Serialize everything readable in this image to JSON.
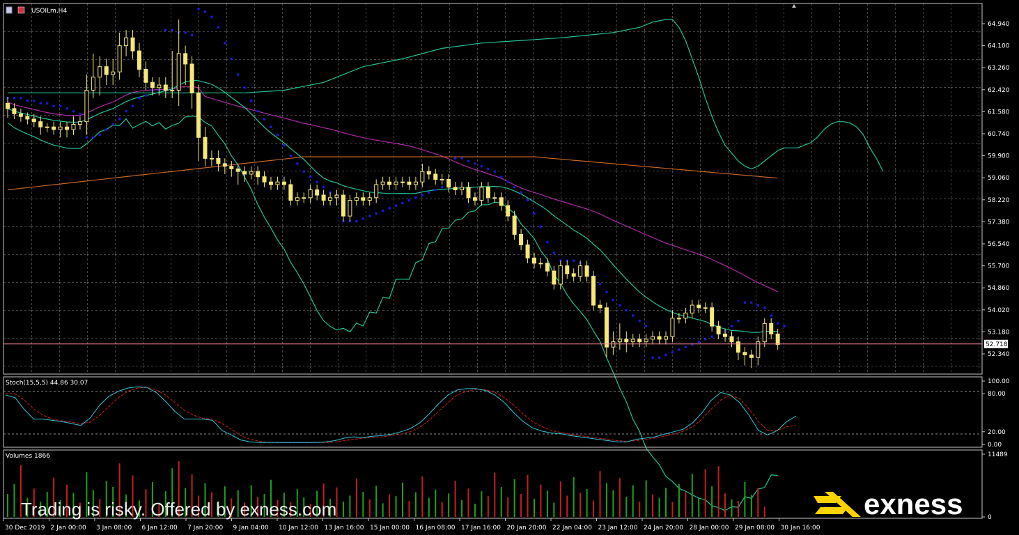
{
  "window": {
    "symbol_title": "USOILm,H4"
  },
  "colors": {
    "background": "#000000",
    "grid": "#8a8a8a",
    "frame": "#c8c8c8",
    "candle": "#f5e878",
    "bollinger": "#22c49a",
    "sar": "#1a1adc",
    "ma_magenta": "#b02aa8",
    "ma_orange": "#c8641e",
    "price_line": "#ff8fa0",
    "stoch_main": "#2ec6d8",
    "stoch_signal": "#d41c1c",
    "vol_up": "#1ea01e",
    "vol_down": "#c81e1e",
    "text": "#ffffff",
    "brand_yellow": "#ffd300"
  },
  "chart_data": [
    {
      "type": "candlestick",
      "title": "USOILm,H4",
      "price_axis_ticks": [
        "64.940",
        "64.100",
        "63.260",
        "62.420",
        "61.580",
        "60.740",
        "59.900",
        "59.060",
        "58.220",
        "57.380",
        "56.540",
        "55.700",
        "54.860",
        "54.020",
        "53.180",
        "52.340"
      ],
      "ylim": [
        51.85,
        65.5
      ],
      "current_price": "52.718",
      "time_axis_labels": [
        "30 Dec 2019",
        "2 Jan 00:00",
        "3 Jan 08:00",
        "6 Jan 12:00",
        "7 Jan 20:00",
        "9 Jan 04:00",
        "10 Jan 12:00",
        "13 Jan 16:00",
        "15 Jan 00:00",
        "16 Jan 08:00",
        "17 Jan 16:00",
        "20 Jan 20:00",
        "22 Jan 04:00",
        "23 Jan 12:00",
        "24 Jan 20:00",
        "28 Jan 00:00",
        "29 Jan 08:00",
        "30 Jan 16:00"
      ],
      "close": [
        61.7,
        61.5,
        61.4,
        61.3,
        61.2,
        61.0,
        61.0,
        60.9,
        61.0,
        60.9,
        61.1,
        61.2,
        62.4,
        62.9,
        63.3,
        63.0,
        63.1,
        64.1,
        64.4,
        63.9,
        63.2,
        62.7,
        62.5,
        62.6,
        62.4,
        62.4,
        63.8,
        63.4,
        62.3,
        60.6,
        59.8,
        59.8,
        59.6,
        59.5,
        59.4,
        59.3,
        59.2,
        59.3,
        59.1,
        58.9,
        58.8,
        58.9,
        58.8,
        58.2,
        58.3,
        58.3,
        58.6,
        58.4,
        58.2,
        58.3,
        58.4,
        57.6,
        58.2,
        58.3,
        58.2,
        58.3,
        58.8,
        58.9,
        58.8,
        58.9,
        58.9,
        58.8,
        58.9,
        59.3,
        59.2,
        59.0,
        59.0,
        58.7,
        58.6,
        58.7,
        58.3,
        58.2,
        58.7,
        58.3,
        58.3,
        58.0,
        57.6,
        56.9,
        56.5,
        56.0,
        55.8,
        55.8,
        55.5,
        55.0,
        55.7,
        55.4,
        55.3,
        55.7,
        55.3,
        54.2,
        54.1,
        52.6,
        52.8,
        52.9,
        52.8,
        52.9,
        52.8,
        52.9,
        53.0,
        52.9,
        53.0,
        53.7,
        53.7,
        53.9,
        54.2,
        54.1,
        54.1,
        53.4,
        53.1,
        53.0,
        52.8,
        52.4,
        52.3,
        52.2,
        52.8,
        53.5,
        53.1,
        52.7
      ],
      "open_first": 61.9,
      "high_ext": [
        0.25,
        0.2,
        0.2,
        0.15,
        0.2,
        0.2,
        0.15,
        0.2,
        0.2,
        0.2,
        0.3,
        0.2,
        0.6,
        0.9,
        0.4,
        0.3,
        0.5,
        0.5,
        0.3,
        0.3,
        0.3,
        0.3,
        0.2,
        0.3,
        0.3,
        1.5,
        1.3,
        0.3,
        0.3,
        0.3,
        0.4,
        0.3,
        0.3,
        0.2,
        0.2,
        0.2,
        0.2,
        0.2,
        0.2,
        0.2,
        0.2,
        0.2,
        0.2,
        0.2,
        0.2,
        0.2,
        0.2,
        0.2,
        0.2,
        0.2,
        0.2,
        0.2,
        0.2,
        0.2,
        0.2,
        0.2,
        0.2,
        0.2,
        0.2,
        0.2,
        0.2,
        0.2,
        0.2,
        0.3,
        0.2,
        0.2,
        0.2,
        0.2,
        0.2,
        0.2,
        0.2,
        0.2,
        0.2,
        0.2,
        0.2,
        0.2,
        0.2,
        0.2,
        0.2,
        0.2,
        0.2,
        0.2,
        0.2,
        0.2,
        0.2,
        0.2,
        0.2,
        0.2,
        0.2,
        0.2,
        0.2,
        0.2,
        0.4,
        0.6,
        0.3,
        0.2,
        0.2,
        0.2,
        0.2,
        0.2,
        0.2,
        0.3,
        0.2,
        0.2,
        0.2,
        0.2,
        0.2,
        0.2,
        0.2,
        0.2,
        0.2,
        0.2,
        0.2,
        0.2,
        0.2,
        0.2,
        0.2,
        0.2
      ],
      "low_ext": [
        0.35,
        0.2,
        0.2,
        0.2,
        0.2,
        0.3,
        0.2,
        0.2,
        0.3,
        0.3,
        0.2,
        0.2,
        0.5,
        0.3,
        0.7,
        0.4,
        0.4,
        0.3,
        0.4,
        0.3,
        0.3,
        0.3,
        0.3,
        0.3,
        0.3,
        0.3,
        0.6,
        0.8,
        0.6,
        0.9,
        0.3,
        0.3,
        0.3,
        0.3,
        0.3,
        0.5,
        0.3,
        0.2,
        0.3,
        0.2,
        0.2,
        0.2,
        0.2,
        0.2,
        0.2,
        0.2,
        0.2,
        0.2,
        0.2,
        0.2,
        0.3,
        0.2,
        0.2,
        0.2,
        0.2,
        0.2,
        0.2,
        0.2,
        0.2,
        0.2,
        0.2,
        0.2,
        0.2,
        0.2,
        0.2,
        0.2,
        0.2,
        0.2,
        0.2,
        0.2,
        0.2,
        0.2,
        0.2,
        0.2,
        0.2,
        0.2,
        0.2,
        0.2,
        0.2,
        0.2,
        0.2,
        0.2,
        0.2,
        0.2,
        0.2,
        0.2,
        0.2,
        0.2,
        0.2,
        0.2,
        0.2,
        0.4,
        0.3,
        0.3,
        0.4,
        0.2,
        0.2,
        0.2,
        0.2,
        0.2,
        0.2,
        0.2,
        0.2,
        0.2,
        0.2,
        0.2,
        0.2,
        0.2,
        0.2,
        0.2,
        0.2,
        0.3,
        0.4,
        0.4,
        0.3,
        0.2,
        0.2,
        0.2
      ],
      "bollinger_upper": [
        62.3,
        62.3,
        62.3,
        62.3,
        62.3,
        62.3,
        62.3,
        62.4,
        62.7,
        63.3,
        63.6,
        64.0,
        64.2,
        64.3,
        64.4,
        64.5,
        64.6,
        64.7,
        64.8,
        64.9,
        65.0,
        65.05,
        65.1,
        65.1,
        64.8,
        64.3,
        63.6,
        62.9,
        62.1,
        61.4,
        60.8,
        60.3,
        60.0,
        59.7,
        59.5,
        59.4,
        59.5,
        59.7,
        59.9,
        60.1,
        60.2,
        60.2,
        60.2,
        60.3,
        60.4,
        60.6,
        60.9,
        61.1,
        61.2,
        61.2,
        61.15,
        61.0,
        60.7,
        60.2,
        59.8,
        59.3
      ],
      "bollinger_upper_x": [
        0,
        6,
        12,
        18,
        24,
        30,
        36,
        42,
        48,
        54,
        60,
        66,
        72,
        78,
        84,
        88,
        92,
        94,
        96,
        97,
        98,
        99,
        100,
        101,
        102,
        103,
        104,
        105,
        106,
        107,
        108,
        109,
        110,
        111,
        112,
        113,
        114,
        115,
        116,
        117,
        118,
        119,
        120,
        121,
        122,
        123,
        124,
        125,
        126,
        127,
        128,
        129,
        130,
        131,
        132,
        133
      ],
      "parabolic_sar": [
        62.1,
        62.1,
        62.1,
        62.0,
        62.0,
        61.9,
        61.9,
        61.8,
        61.8,
        61.7,
        61.6,
        61.5,
        60.6,
        60.6,
        60.7,
        60.9,
        61.1,
        61.3,
        61.6,
        61.8,
        62.1,
        62.2,
        62.4,
        62.4,
        64.7,
        64.7,
        64.6,
        64.6,
        64.5,
        65.5,
        65.4,
        65.2,
        64.8,
        64.2,
        63.6,
        63.0,
        62.5,
        62.0,
        61.6,
        61.3,
        61.0,
        60.7,
        60.3,
        59.9,
        59.6,
        59.3,
        59.1,
        58.9,
        58.7,
        58.5,
        58.4,
        57.4,
        57.4,
        57.4,
        57.5,
        57.6,
        57.7,
        57.8,
        57.9,
        58.0,
        58.1,
        58.2,
        58.3,
        58.4,
        58.5,
        58.6,
        58.7,
        58.8,
        59.8,
        59.8,
        59.7,
        59.6,
        59.5,
        59.4,
        59.3,
        59.1,
        58.9,
        58.7,
        58.5,
        58.2,
        57.7,
        57.2,
        56.6,
        56.2,
        55.9,
        55.9,
        55.9,
        55.8,
        55.6,
        55.3,
        55.0,
        54.7,
        54.4,
        54.2,
        54.0,
        53.8,
        53.6,
        53.4,
        52.2,
        52.2,
        52.3,
        52.4,
        52.5,
        52.6,
        52.7,
        52.8,
        52.9,
        53.0,
        53.1,
        53.2,
        53.4,
        53.6,
        54.3,
        54.3,
        54.2,
        54.1,
        53.8,
        53.5,
        53.4
      ]
    },
    {
      "type": "line",
      "title": "Stoch(15,5,5) 44.86 30.07",
      "axis_ticks": [
        "100.00",
        "80.00",
        "20.00",
        "0.00"
      ],
      "ylim": [
        0,
        100
      ],
      "series_main": [
        78,
        74,
        55,
        40,
        40,
        38,
        36,
        33,
        30,
        42,
        62,
        76,
        84,
        89,
        91,
        90,
        82,
        68,
        52,
        40,
        40,
        40,
        38,
        22,
        15,
        7,
        4,
        3,
        3,
        3,
        3,
        3,
        3,
        3,
        4,
        6,
        10,
        12,
        11,
        13,
        14,
        16,
        20,
        25,
        34,
        48,
        64,
        78,
        86,
        88,
        88,
        85,
        78,
        66,
        50,
        36,
        26,
        21,
        18,
        17,
        14,
        12,
        10,
        8,
        6,
        4,
        4,
        8,
        10,
        12,
        16,
        20,
        24,
        34,
        50,
        70,
        82,
        78,
        66,
        46,
        22,
        15,
        22,
        36,
        44.86
      ],
      "series_signal": [
        80,
        80,
        70,
        56,
        46,
        40,
        37,
        35,
        33,
        35,
        46,
        60,
        74,
        84,
        89,
        90,
        86,
        78,
        66,
        54,
        46,
        41,
        40,
        33,
        24,
        14,
        8,
        5,
        3,
        3,
        3,
        3,
        3,
        3,
        3,
        4,
        6,
        8,
        10,
        11,
        12,
        14,
        16,
        20,
        27,
        38,
        52,
        66,
        78,
        84,
        87,
        86,
        82,
        74,
        62,
        48,
        36,
        28,
        22,
        19,
        16,
        14,
        12,
        10,
        8,
        6,
        5,
        6,
        8,
        10,
        13,
        16,
        21,
        28,
        40,
        56,
        70,
        78,
        72,
        56,
        36,
        22,
        22,
        28,
        30.07
      ]
    },
    {
      "type": "bar",
      "title": "Volumes 1866",
      "axis_ticks": [
        "11489",
        "0"
      ],
      "ylim": [
        0,
        11489
      ],
      "values": [
        4200,
        6000,
        9500,
        3500,
        5200,
        2800,
        4600,
        7200,
        3100,
        5900,
        4400,
        2600,
        8200,
        4900,
        3300,
        6600,
        5500,
        9800,
        4100,
        7600,
        3000,
        5100,
        6400,
        2300,
        4700,
        8900,
        10200,
        5300,
        7800,
        3900,
        6200,
        4500,
        2900,
        5600,
        3400,
        4900,
        2600,
        5800,
        3700,
        4200,
        6800,
        3100,
        4400,
        2700,
        5100,
        3600,
        2400,
        4800,
        6100,
        3300,
        5400,
        2800,
        3900,
        7000,
        4600,
        3200,
        5700,
        2500,
        4100,
        3800,
        6300,
        2900,
        4500,
        7400,
        3500,
        5000,
        2700,
        4300,
        6600,
        3100,
        5200,
        2400,
        4700,
        3800,
        8100,
        5500,
        3600,
        6900,
        4200,
        7700,
        3300,
        5900,
        4800,
        2600,
        6500,
        3900,
        7300,
        4400,
        5100,
        3000,
        8400,
        6200,
        4900,
        7100,
        3700,
        5800,
        2800,
        6700,
        4100,
        3500,
        5300,
        2700,
        6000,
        4500,
        7900,
        3400,
        8800,
        5600,
        9300,
        4300,
        3200,
        2900,
        6400,
        4000,
        5300,
        1866
      ],
      "up": [
        1,
        1,
        0,
        1,
        0,
        1,
        1,
        0,
        1,
        0,
        1,
        0,
        1,
        1,
        0,
        1,
        1,
        0,
        1,
        0,
        1,
        0,
        1,
        0,
        1,
        1,
        0,
        1,
        0,
        0,
        1,
        0,
        1,
        1,
        0,
        1,
        0,
        1,
        0,
        1,
        1,
        0,
        1,
        0,
        1,
        1,
        0,
        1,
        0,
        1,
        0,
        1,
        1,
        0,
        1,
        0,
        1,
        1,
        0,
        1,
        1,
        0,
        1,
        0,
        1,
        1,
        0,
        1,
        0,
        1,
        0,
        1,
        1,
        0,
        0,
        1,
        0,
        1,
        0,
        0,
        1,
        0,
        1,
        1,
        0,
        0,
        1,
        0,
        1,
        0,
        0,
        1,
        1,
        0,
        1,
        1,
        0,
        1,
        0,
        1,
        1,
        0,
        1,
        0,
        1,
        1,
        0,
        1,
        0,
        0,
        1,
        0,
        1,
        1,
        0,
        0
      ]
    }
  ],
  "watermark": {
    "disclaimer": "Trading is risky. Offered by exness.com",
    "brand": "exness"
  }
}
